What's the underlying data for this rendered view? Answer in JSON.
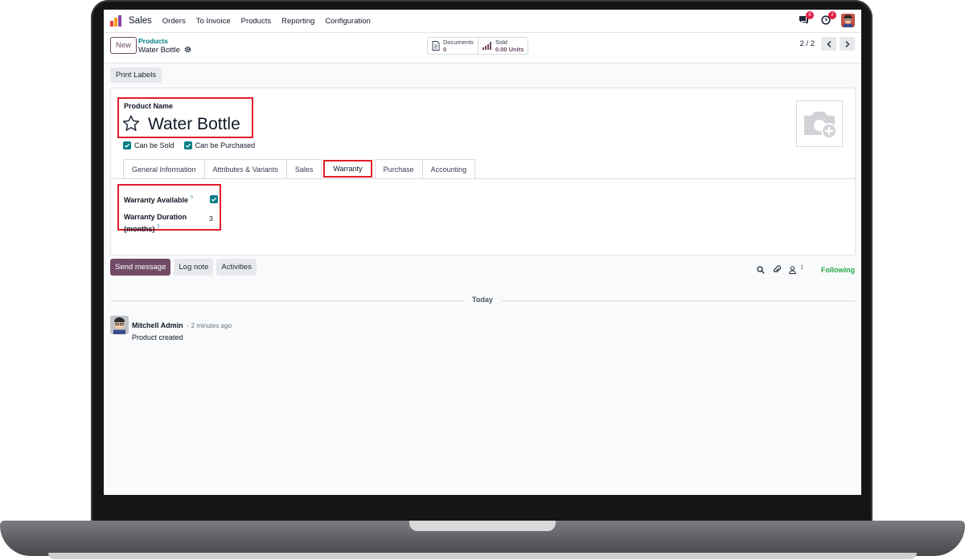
{
  "navbar": {
    "app_name": "Sales",
    "menu": [
      "Orders",
      "To Invoice",
      "Products",
      "Reporting",
      "Configuration"
    ],
    "messages_badge": "6",
    "activities_badge": "2"
  },
  "control_panel": {
    "new_label": "New",
    "breadcrumb_parent": "Products",
    "breadcrumb_current": "Water Bottle",
    "smart_buttons": {
      "documents": {
        "label": "Documents",
        "value": "0"
      },
      "sold": {
        "label": "Sold",
        "value": "0.00 Units"
      }
    },
    "pager": "2 / 2"
  },
  "status_bar": {
    "print_labels": "Print Labels"
  },
  "form": {
    "product_name_label": "Product Name",
    "product_name": "Water Bottle",
    "can_be_sold_label": "Can be Sold",
    "can_be_purchased_label": "Can be Purchased",
    "tabs": [
      "General Information",
      "Attributes & Variants",
      "Sales",
      "Warranty",
      "Purchase",
      "Accounting"
    ],
    "active_tab": "Warranty",
    "warranty_available_label": "Warranty Available",
    "warranty_duration_label_1": "Warranty Duration",
    "warranty_duration_label_2": "(months)",
    "help_mark": "?",
    "warranty_duration_value": "3"
  },
  "chatter": {
    "send_message": "Send message",
    "log_note": "Log note",
    "activities": "Activities",
    "follower_count": "1",
    "following": "Following",
    "date_separator": "Today",
    "messages": [
      {
        "author": "Mitchell Admin",
        "time": "- 2 minutes ago",
        "body": "Product created"
      }
    ]
  },
  "colors": {
    "brand": "#714b67",
    "teal": "#017e84",
    "highlight_red": "#e11d2a",
    "following_green": "#28a745"
  }
}
